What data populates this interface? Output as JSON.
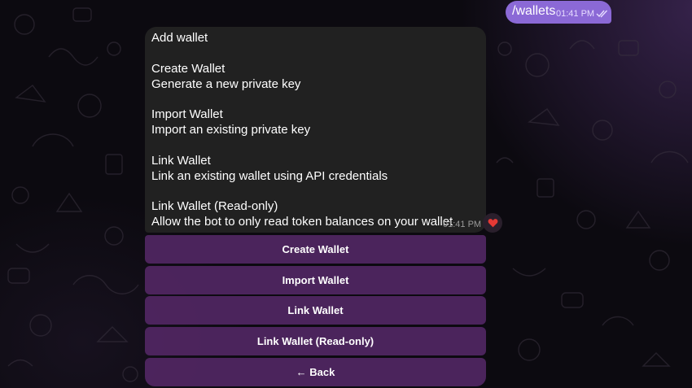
{
  "outgoing": {
    "text": "/wallets",
    "time": "01:41 PM",
    "status_icon": "double-check-icon"
  },
  "incoming": {
    "lines": [
      "Add wallet",
      "",
      "Create Wallet",
      "Generate a new private key",
      "",
      "Import Wallet",
      "Import an existing private key",
      "",
      "Link Wallet",
      "Link an existing wallet using API credentials",
      "",
      "Link Wallet (Read-only)",
      "Allow the bot to only read token balances on your wallet"
    ],
    "time": "01:41 PM",
    "reaction": "heart-icon"
  },
  "keyboard": {
    "create": "Create Wallet",
    "import": "Import Wallet",
    "link": "Link Wallet",
    "link_readonly": "Link Wallet (Read-only)",
    "back": "← Back"
  },
  "colors": {
    "outgoing_bubble": "#8b69d6",
    "incoming_bubble": "#212121",
    "keyboard_button": "#542866",
    "reaction_heart": "#e53935"
  }
}
